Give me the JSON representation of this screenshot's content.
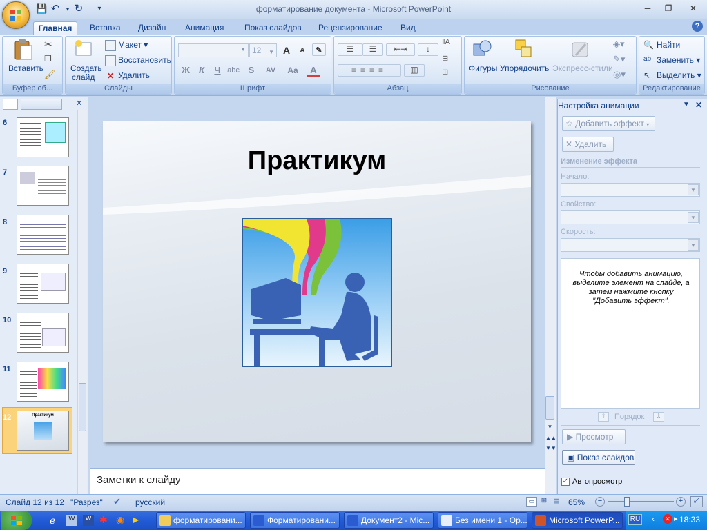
{
  "window": {
    "title": "форматирование документа - Microsoft PowerPoint"
  },
  "tabs": [
    "Главная",
    "Вставка",
    "Дизайн",
    "Анимация",
    "Показ слайдов",
    "Рецензирование",
    "Вид"
  ],
  "ribbon": {
    "clipboard": {
      "paste": "Вставить",
      "label": "Буфер об..."
    },
    "slides": {
      "new_slide_1": "Создать",
      "new_slide_2": "слайд",
      "layout": "Макет",
      "reset": "Восстановить",
      "delete": "Удалить",
      "label": "Слайды"
    },
    "font": {
      "size": "12",
      "bold": "Ж",
      "italic": "К",
      "underline": "Ч",
      "strike": "abc",
      "shadow": "S",
      "spacing": "AV",
      "case": "Aa",
      "color": "A",
      "grow": "A",
      "shrink": "A",
      "label": "Шрифт"
    },
    "paragraph": {
      "label": "Абзац"
    },
    "drawing": {
      "shapes": "Фигуры",
      "arrange": "Упорядочить",
      "styles": "Экспресс-стили",
      "label": "Рисование"
    },
    "editing": {
      "find": "Найти",
      "replace": "Заменить",
      "select": "Выделить",
      "label": "Редактирование"
    }
  },
  "thumbnails": [
    {
      "num": "6"
    },
    {
      "num": "7"
    },
    {
      "num": "8"
    },
    {
      "num": "9"
    },
    {
      "num": "10"
    },
    {
      "num": "11"
    },
    {
      "num": "12",
      "title": "Практикум"
    }
  ],
  "slide": {
    "title": "Практикум"
  },
  "notes": {
    "placeholder": "Заметки к слайду"
  },
  "animation_pane": {
    "title": "Настройка анимации",
    "add_effect": "Добавить эффект",
    "remove": "Удалить",
    "change_effect": "Изменение эффекта",
    "start_label": "Начало:",
    "property_label": "Свойство:",
    "speed_label": "Скорость:",
    "hint": "Чтобы добавить анимацию, выделите элемент на слайде, а затем нажмите кнопку \"Добавить эффект\".",
    "order": "Порядок",
    "preview": "Просмотр",
    "slideshow": "Показ слайдов",
    "autopreview": "Автопросмотр",
    "autopreview_checked": true
  },
  "status": {
    "slide": "Слайд 12 из 12",
    "theme": "\"Разрез\"",
    "language": "русский",
    "zoom": "65%"
  },
  "taskbar": {
    "items": [
      "форматировани...",
      "Форматировани...",
      "Документ2 - Mic...",
      "Без имени 1 - Op...",
      "Microsoft PowerP..."
    ],
    "lang": "RU",
    "time": "18:33"
  }
}
